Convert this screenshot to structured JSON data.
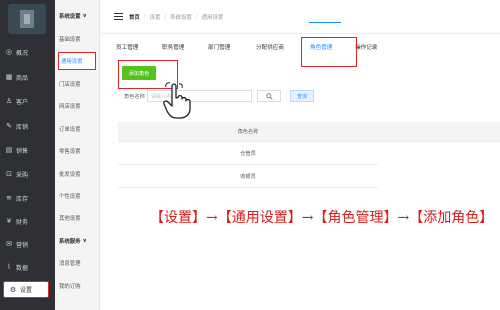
{
  "nav": {
    "items": [
      {
        "label": "概况",
        "icon": "dashboard-icon",
        "glyph": "◎"
      },
      {
        "label": "商品",
        "icon": "grid-icon",
        "glyph": "▦"
      },
      {
        "label": "客户",
        "icon": "user-icon",
        "glyph": "♙"
      },
      {
        "label": "库销",
        "icon": "pen-icon",
        "glyph": "✎"
      },
      {
        "label": "销售",
        "icon": "document-icon",
        "glyph": "▤"
      },
      {
        "label": "采购",
        "icon": "box-icon",
        "glyph": "⊡"
      },
      {
        "label": "库存",
        "icon": "stack-icon",
        "glyph": "≋"
      },
      {
        "label": "财务",
        "icon": "yen-icon",
        "glyph": "¥"
      },
      {
        "label": "营销",
        "icon": "gift-icon",
        "glyph": "✉"
      },
      {
        "label": "数据",
        "icon": "chart-icon",
        "glyph": "⌇"
      },
      {
        "label": "设置",
        "icon": "gear-icon",
        "glyph": "⚙"
      }
    ]
  },
  "submenu": {
    "header1": "系统设置",
    "items": [
      "基础设置",
      "通用设置",
      "门店设置",
      "网店设置",
      "订单设置",
      "零售设置",
      "批发设置",
      "个性设置",
      "其他设置"
    ],
    "header2": "系统服务",
    "items2": [
      "消息管理",
      "我的订购"
    ],
    "chevron": "∨"
  },
  "breadcrumb": {
    "home": "首页",
    "items": [
      "设置",
      "系统设置",
      "通用设置"
    ],
    "separator": "/"
  },
  "tabs": [
    "员工管理",
    "职务管理",
    "部门管理",
    "分配供应商",
    "角色管理",
    "操作记录"
  ],
  "add_button": "添加角色",
  "search": {
    "label": "角色名称",
    "placeholder": "请输入内容",
    "search_icon": "search-icon",
    "query_button": "查询"
  },
  "table": {
    "header": "角色名称",
    "rows": [
      "仓管员",
      "收银员"
    ]
  },
  "instruction": "【设置】→【通用设置】→【角色管理】→【添加角色】",
  "colors": {
    "nav_bg": "#2e3035",
    "highlight": "#e02727",
    "primary": "#1890ff",
    "add_button": "#52c41a"
  }
}
